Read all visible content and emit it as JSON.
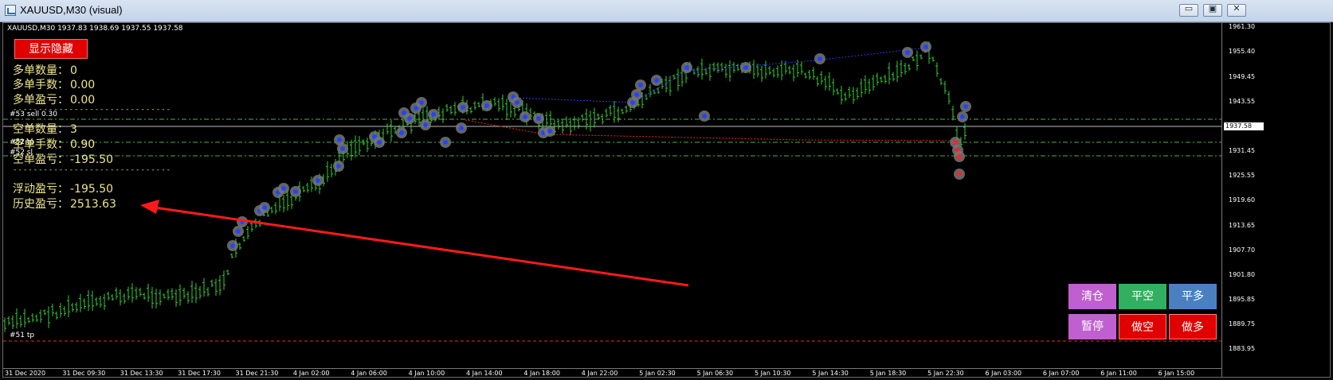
{
  "window": {
    "title": "XAUUSD,M30 (visual)",
    "buttons": {
      "minimize": "▭",
      "restore": "▣",
      "close": "✕"
    }
  },
  "chart": {
    "ohlc_header": "XAUUSD,M30  1937.83 1938.69 1937.55 1937.58",
    "current_price": "1937.58",
    "price_labels": [
      "1961.30",
      "1955.40",
      "1949.45",
      "1943.55",
      "1937.58",
      "1931.45",
      "1925.55",
      "1919.60",
      "1913.65",
      "1907.70",
      "1901.80",
      "1895.85",
      "1889.75",
      "1883.95"
    ],
    "time_labels": [
      "31 Dec 2020",
      "31 Dec 09:30",
      "31 Dec 13:30",
      "31 Dec 17:30",
      "31 Dec 21:30",
      "4 Jan 02:00",
      "4 Jan 06:00",
      "4 Jan 10:00",
      "4 Jan 14:00",
      "4 Jan 18:00",
      "4 Jan 22:00",
      "5 Jan 02:30",
      "5 Jan 06:30",
      "5 Jan 10:30",
      "5 Jan 14:30",
      "5 Jan 18:30",
      "5 Jan 22:30",
      "6 Jan 03:00",
      "6 Jan 07:00",
      "6 Jan 11:00",
      "6 Jan 15:00"
    ],
    "order_labels": {
      "sell": "#53 sell 0.30",
      "tp": "#52 tp",
      "sl": "#52 sl",
      "tp2": "#51 tp"
    },
    "colors": {
      "candle": "#33cc33",
      "level_line": "#4caf50",
      "sell_line": "#ff2222",
      "buy_line": "#3333ff",
      "arrow": "#ff1a1a",
      "panel_text": "#f0e68c"
    }
  },
  "panel": {
    "toggle_button": "显示隐藏",
    "rows": [
      {
        "label": "多单数量：",
        "value": "0"
      },
      {
        "label": "多单手数：",
        "value": "0.00"
      },
      {
        "label": "多单盈亏：",
        "value": "0.00"
      },
      {
        "label": "空单数量：",
        "value": "3"
      },
      {
        "label": "空单手数：",
        "value": "0.90"
      },
      {
        "label": "空单盈亏：",
        "value": "-195.50"
      },
      {
        "label": "浮动盈亏：",
        "value": "-195.50"
      },
      {
        "label": "历史盈亏：",
        "value": "2513.63"
      }
    ],
    "separator": "-------------------------------"
  },
  "trade_buttons": [
    {
      "label": "清仓",
      "color": "#c060d0"
    },
    {
      "label": "平空",
      "color": "#30b060"
    },
    {
      "label": "平多",
      "color": "#4a80c0"
    },
    {
      "label": "暂停",
      "color": "#c060d0"
    },
    {
      "label": "做空",
      "color": "#e00000"
    },
    {
      "label": "做多",
      "color": "#e00000"
    }
  ]
}
